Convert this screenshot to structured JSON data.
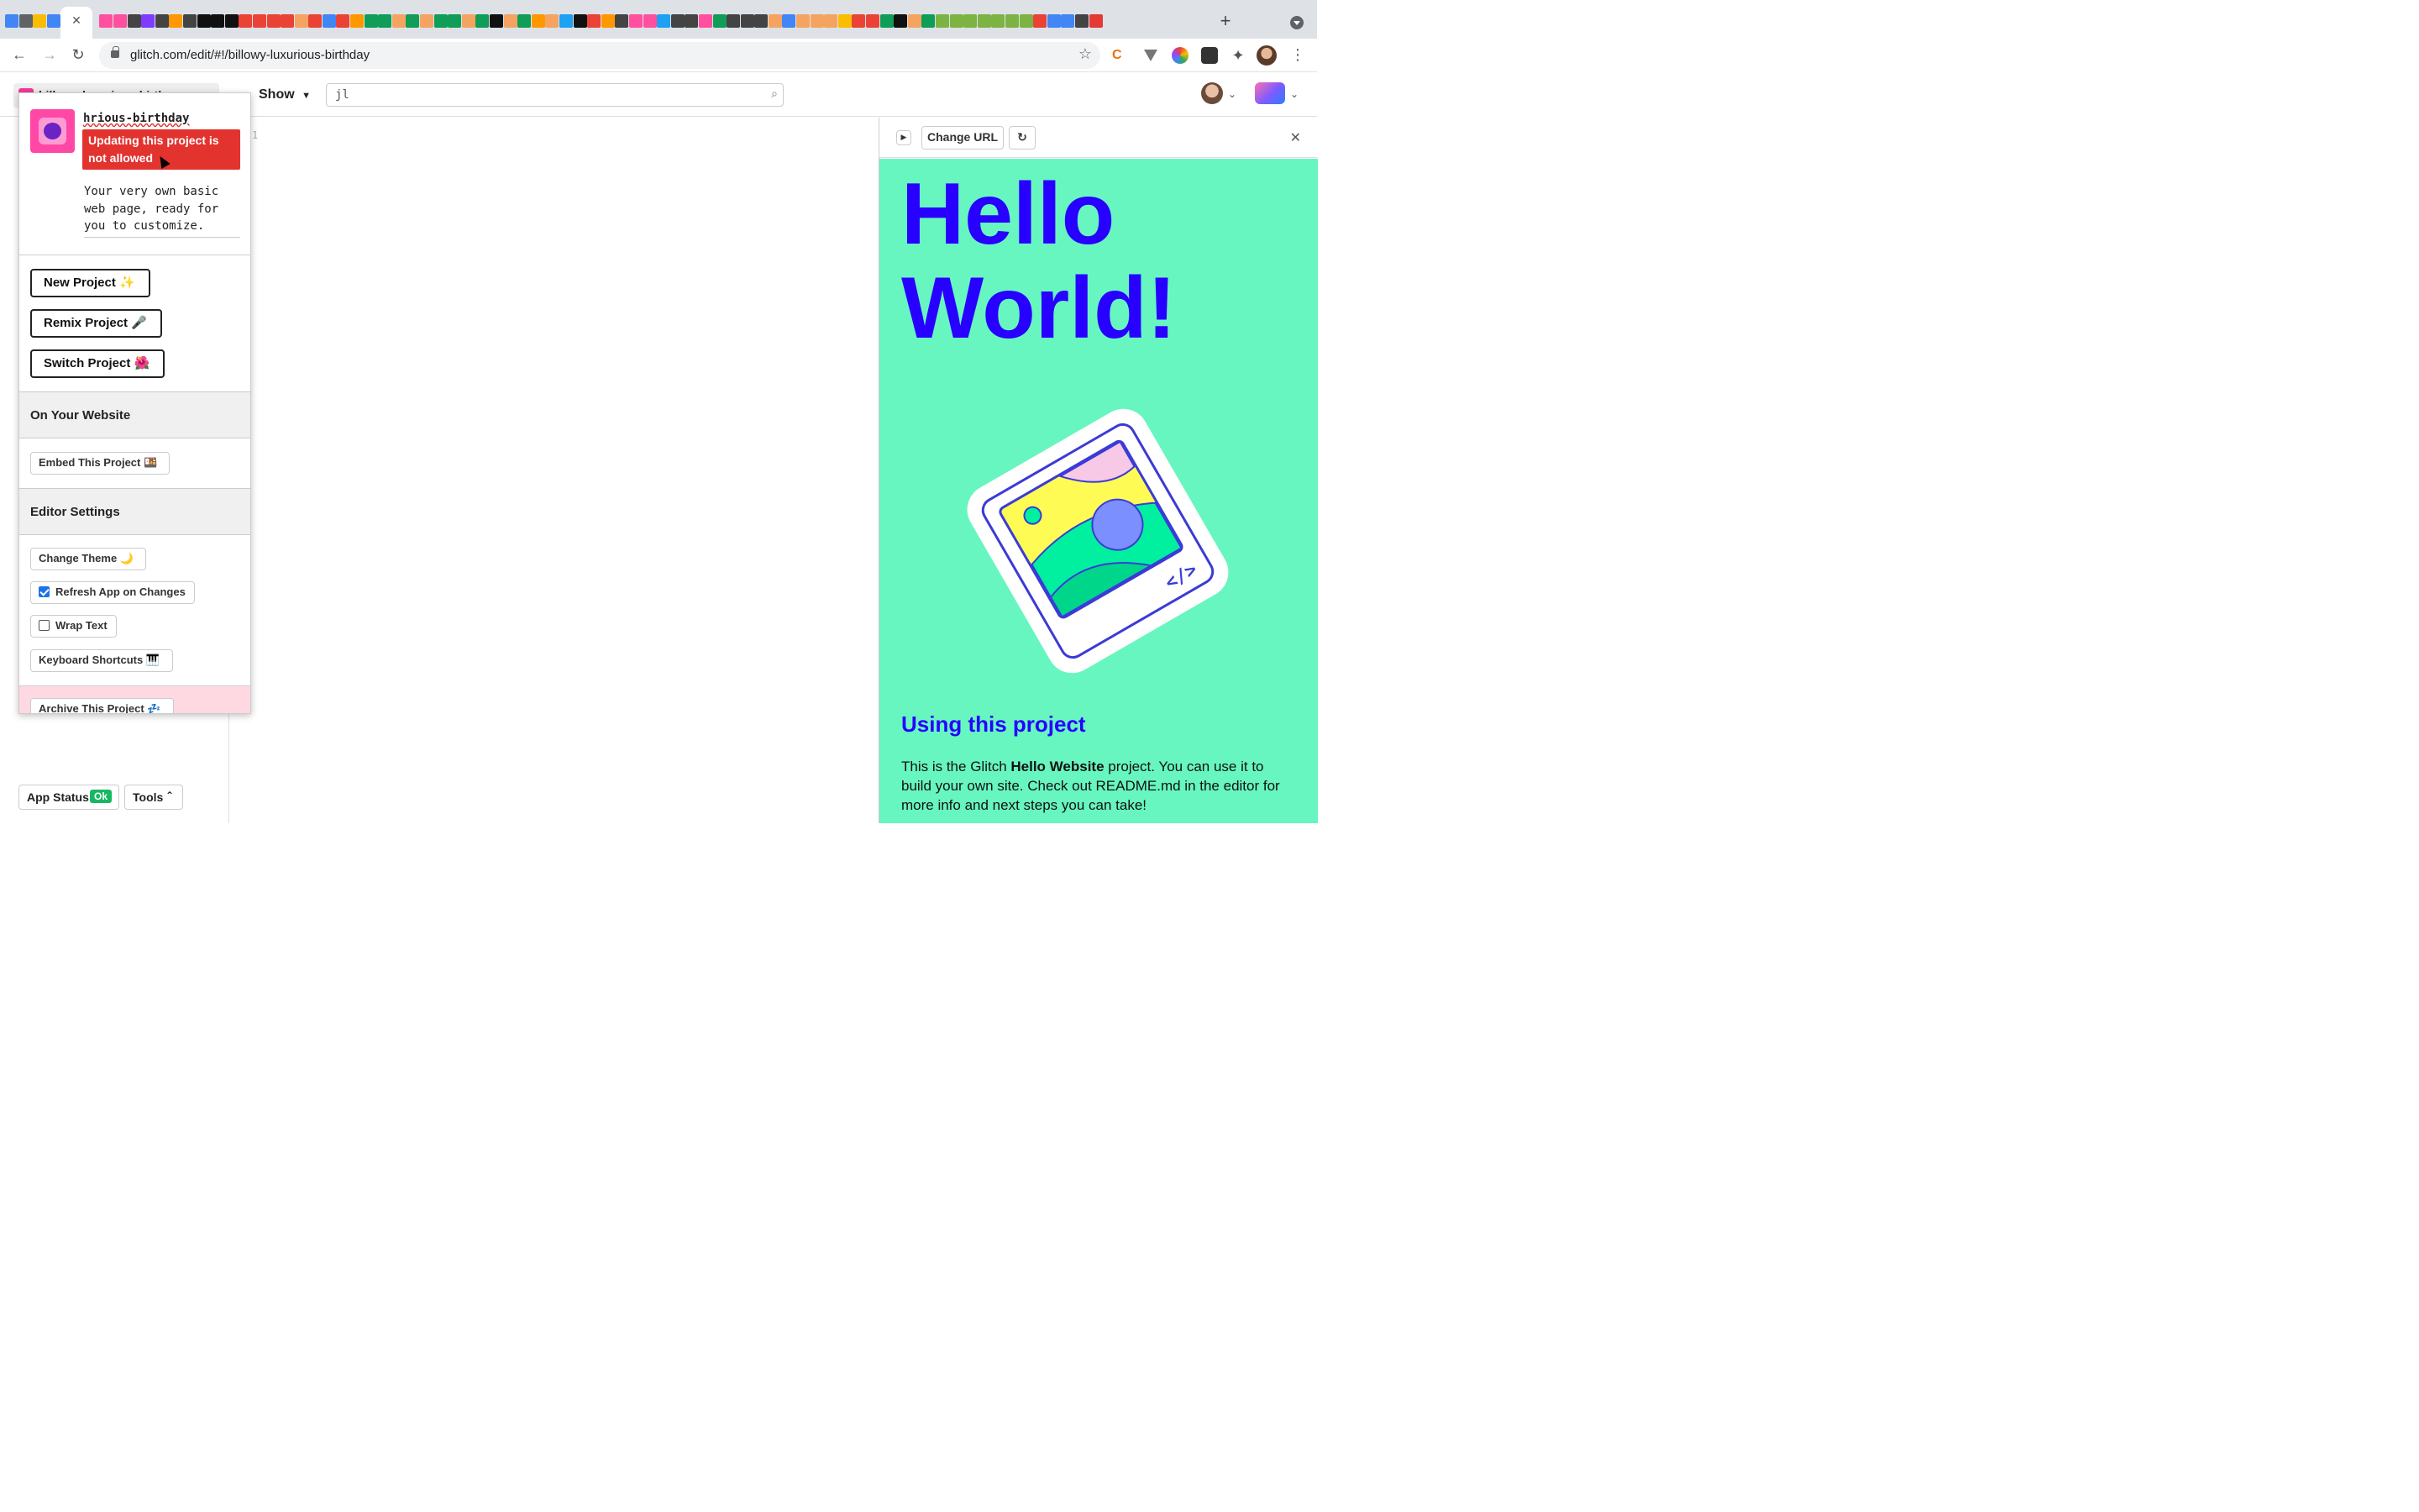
{
  "browser": {
    "url": "glitch.com/edit/#!/billowy-luxurious-birthday",
    "favicon_colors": [
      "#4285f4",
      "#5f6368",
      "#fbbc04",
      "#4285f4",
      "#ff4f9e",
      "#ff4f9e",
      "#444",
      "#7d3cff",
      "#444",
      "#ff9800",
      "#444",
      "#111",
      "#111",
      "#111",
      "#ea4335",
      "#ea4335",
      "#ea4335",
      "#ea4335",
      "#f4a460",
      "#ea4335",
      "#4285f4",
      "#ea4335",
      "#ff9800",
      "#0f9d58",
      "#0f9d58",
      "#f4a460",
      "#0f9d58",
      "#f4a460",
      "#0f9d58",
      "#0f9d58",
      "#f4a460",
      "#0f9d58",
      "#111",
      "#f4a460",
      "#0f9d58",
      "#ff9800",
      "#f4a460",
      "#1da1f2",
      "#111",
      "#ea4335",
      "#ff9800",
      "#444",
      "#ff4f9e",
      "#ff4f9e",
      "#1da1f2",
      "#444",
      "#444",
      "#ff4f9e",
      "#0f9d58",
      "#444",
      "#444",
      "#444",
      "#f4a460",
      "#4285f4",
      "#f4a460",
      "#f4a460",
      "#f4a460",
      "#fbbc04",
      "#ea4335",
      "#ea4335",
      "#0f9d58",
      "#111",
      "#f4a460",
      "#0f9d58",
      "#7cb342",
      "#7cb342",
      "#7cb342",
      "#7cb342",
      "#7cb342",
      "#7cb342",
      "#7cb342",
      "#ea4335",
      "#4285f4",
      "#4285f4",
      "#444",
      "#e53935"
    ],
    "tab_close": "✕",
    "new_tab": "+"
  },
  "header": {
    "project_name": "billowy-luxurious-birth",
    "show_label": "Show",
    "search_value": "jl",
    "search_placeholder": ""
  },
  "popup": {
    "project_name": "hrious-birthday",
    "error": "Updating this project is not allowed",
    "description": "Your very own basic web page, ready for you to customize.",
    "buttons": [
      {
        "label": "New Project ✨"
      },
      {
        "label": "Remix Project 🎤"
      },
      {
        "label": "Switch Project 🌺"
      }
    ],
    "section_website": "On Your Website",
    "embed_label": "Embed This Project 🍱",
    "section_editor": "Editor Settings",
    "change_theme": "Change Theme 🌙",
    "refresh_app": "Refresh App on Changes",
    "wrap_text": "Wrap Text",
    "keyboard_shortcuts": "Keyboard Shortcuts 🎹",
    "archive": "Archive This Project 💤"
  },
  "editor": {
    "line_number": "1"
  },
  "sidebar": {
    "app_status": "App Status",
    "ok_badge": "Ok",
    "tools": "Tools"
  },
  "preview": {
    "change_url": "Change URL",
    "hello_line1": "Hello",
    "hello_line2": "World!",
    "using_title": "Using this project",
    "using_text_1": "This is the Glitch ",
    "using_text_bold": "Hello Website",
    "using_text_2": " project. You can use it to build your own site. Check out README.md in the editor for more info and next steps you can take!"
  },
  "colors": {
    "accent": "#2800ff",
    "site_bg": "#67f6c0",
    "error": "#e3332f",
    "ok": "#17b861"
  }
}
